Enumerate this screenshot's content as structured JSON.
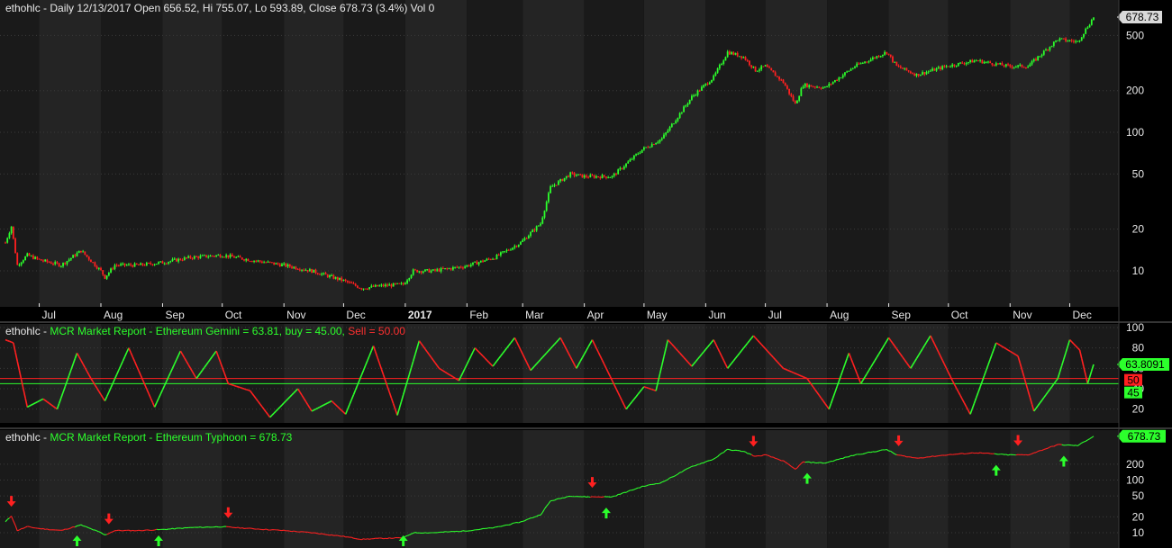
{
  "panel1": {
    "symbol": "ethohlc",
    "header": "Daily 12/13/2017 Open 656.52, Hi 755.07, Lo 593.89, Close 678.73 (3.4%) Vol 0",
    "last_price_label": "678.73"
  },
  "panel2": {
    "symbol": "ethohlc",
    "indicator": "MCR Market Report - Ethereum Gemini = 63.81,",
    "buy": "buy = 45.00,",
    "sell": "Sell = 50.00",
    "value_label": "63.8091",
    "sell_label": "50",
    "buy_label": "45"
  },
  "panel3": {
    "symbol": "ethohlc",
    "indicator": "MCR Market Report - Ethereum Typhoon = 678.73",
    "value_label": "678.73"
  },
  "colors": {
    "up": "#2cff2c",
    "down": "#ff2020",
    "background": "#000000",
    "band_a": "#1a1a1a",
    "band_b": "#242424",
    "grid": "#3a3a3a",
    "axis_text": "#e8e8e8",
    "price_badge": "#d9d9d9"
  },
  "chart_data": [
    {
      "type": "candlestick",
      "title": "ethohlc - Daily 12/13/2017 Open 656.52, Hi 755.07, Lo 593.89, Close 678.73 (3.4%) Vol 0",
      "y_scale": "log",
      "ylim": [
        5.5,
        800
      ],
      "yticks": [
        10,
        20,
        50,
        100,
        200,
        500
      ],
      "x_tick_labels": [
        "Jul",
        "Aug",
        "Sep",
        "Oct",
        "Nov",
        "Dec",
        "2017",
        "Feb",
        "Mar",
        "Apr",
        "May",
        "Jun",
        "Jul",
        "Aug",
        "Sep",
        "Oct",
        "Nov",
        "Dec"
      ],
      "x_range": [
        "2016-06-14",
        "2017-12-13"
      ],
      "close_path": [
        [
          "2016-06-14",
          16
        ],
        [
          "2016-06-17",
          21
        ],
        [
          "2016-06-20",
          11
        ],
        [
          "2016-06-25",
          13
        ],
        [
          "2016-07-01",
          12
        ],
        [
          "2016-07-12",
          11
        ],
        [
          "2016-07-22",
          14
        ],
        [
          "2016-08-01",
          10
        ],
        [
          "2016-08-03",
          9
        ],
        [
          "2016-08-08",
          11
        ],
        [
          "2016-08-20",
          11
        ],
        [
          "2016-09-01",
          11.5
        ],
        [
          "2016-09-15",
          12.5
        ],
        [
          "2016-10-01",
          13
        ],
        [
          "2016-10-15",
          12
        ],
        [
          "2016-11-01",
          11
        ],
        [
          "2016-11-15",
          10
        ],
        [
          "2016-12-01",
          8.5
        ],
        [
          "2016-12-10",
          7.5
        ],
        [
          "2016-12-20",
          7.8
        ],
        [
          "2016-12-31",
          8
        ],
        [
          "2017-01-05",
          10
        ],
        [
          "2017-01-15",
          10
        ],
        [
          "2017-01-31",
          10.8
        ],
        [
          "2017-02-15",
          12.5
        ],
        [
          "2017-02-28",
          16
        ],
        [
          "2017-03-10",
          22
        ],
        [
          "2017-03-15",
          40
        ],
        [
          "2017-03-25",
          50
        ],
        [
          "2017-04-01",
          48
        ],
        [
          "2017-04-15",
          48
        ],
        [
          "2017-04-30",
          75
        ],
        [
          "2017-05-10",
          90
        ],
        [
          "2017-05-25",
          180
        ],
        [
          "2017-06-05",
          250
        ],
        [
          "2017-06-12",
          380
        ],
        [
          "2017-06-20",
          350
        ],
        [
          "2017-06-26",
          280
        ],
        [
          "2017-07-01",
          300
        ],
        [
          "2017-07-10",
          230
        ],
        [
          "2017-07-16",
          160
        ],
        [
          "2017-07-20",
          220
        ],
        [
          "2017-07-31",
          210
        ],
        [
          "2017-08-15",
          300
        ],
        [
          "2017-08-31",
          380
        ],
        [
          "2017-09-05",
          300
        ],
        [
          "2017-09-15",
          260
        ],
        [
          "2017-09-30",
          300
        ],
        [
          "2017-10-15",
          330
        ],
        [
          "2017-10-31",
          300
        ],
        [
          "2017-11-10",
          300
        ],
        [
          "2017-11-25",
          470
        ],
        [
          "2017-12-05",
          450
        ],
        [
          "2017-12-13",
          678.73
        ]
      ]
    },
    {
      "type": "line",
      "title": "ethohlc - MCR Market Report - Ethereum Gemini = 63.81, buy = 45.00, Sell = 50.00",
      "y_scale": "linear",
      "ylim": [
        10,
        100
      ],
      "yticks": [
        20,
        40,
        60,
        80,
        100
      ],
      "sell_level": 50,
      "buy_level": 45,
      "last_value": 63.8091,
      "series": [
        {
          "name": "Ethereum Gemini",
          "points": [
            [
              "2016-06-14",
              88
            ],
            [
              "2016-06-18",
              85
            ],
            [
              "2016-06-25",
              22
            ],
            [
              "2016-07-03",
              30
            ],
            [
              "2016-07-10",
              20
            ],
            [
              "2016-07-20",
              75
            ],
            [
              "2016-07-27",
              50
            ],
            [
              "2016-08-03",
              28
            ],
            [
              "2016-08-15",
              80
            ],
            [
              "2016-08-28",
              22
            ],
            [
              "2016-09-10",
              77
            ],
            [
              "2016-09-18",
              50
            ],
            [
              "2016-09-28",
              77
            ],
            [
              "2016-10-04",
              45
            ],
            [
              "2016-10-15",
              38
            ],
            [
              "2016-10-25",
              12
            ],
            [
              "2016-11-08",
              40
            ],
            [
              "2016-11-15",
              18
            ],
            [
              "2016-11-25",
              28
            ],
            [
              "2016-12-02",
              15
            ],
            [
              "2016-12-16",
              82
            ],
            [
              "2016-12-28",
              14
            ],
            [
              "2017-01-08",
              87
            ],
            [
              "2017-01-18",
              60
            ],
            [
              "2017-01-28",
              48
            ],
            [
              "2017-02-05",
              80
            ],
            [
              "2017-02-14",
              62
            ],
            [
              "2017-02-25",
              90
            ],
            [
              "2017-03-05",
              58
            ],
            [
              "2017-03-20",
              90
            ],
            [
              "2017-03-28",
              60
            ],
            [
              "2017-04-05",
              88
            ],
            [
              "2017-04-12",
              60
            ],
            [
              "2017-04-22",
              20
            ],
            [
              "2017-05-01",
              42
            ],
            [
              "2017-05-07",
              38
            ],
            [
              "2017-05-13",
              88
            ],
            [
              "2017-05-25",
              62
            ],
            [
              "2017-06-05",
              88
            ],
            [
              "2017-06-12",
              60
            ],
            [
              "2017-06-25",
              92
            ],
            [
              "2017-07-10",
              60
            ],
            [
              "2017-07-22",
              50
            ],
            [
              "2017-08-02",
              20
            ],
            [
              "2017-08-12",
              75
            ],
            [
              "2017-08-18",
              45
            ],
            [
              "2017-09-01",
              90
            ],
            [
              "2017-09-12",
              60
            ],
            [
              "2017-09-22",
              92
            ],
            [
              "2017-10-03",
              48
            ],
            [
              "2017-10-12",
              15
            ],
            [
              "2017-10-25",
              85
            ],
            [
              "2017-11-05",
              72
            ],
            [
              "2017-11-13",
              18
            ],
            [
              "2017-11-25",
              50
            ],
            [
              "2017-12-01",
              88
            ],
            [
              "2017-12-06",
              78
            ],
            [
              "2017-12-10",
              45
            ],
            [
              "2017-12-13",
              63.81
            ]
          ]
        }
      ]
    },
    {
      "type": "line",
      "title": "ethohlc - MCR Market Report - Ethereum Typhoon = 678.73",
      "y_scale": "log",
      "ylim": [
        6,
        700
      ],
      "yticks": [
        10,
        20,
        50,
        100,
        200
      ],
      "last_value": 678.73,
      "signals": {
        "sell": [
          "2016-06-17",
          "2016-08-05",
          "2016-10-04",
          "2017-04-05",
          "2017-06-25",
          "2017-09-06",
          "2017-11-05"
        ],
        "buy": [
          "2016-07-20",
          "2016-08-30",
          "2016-12-31",
          "2017-04-12",
          "2017-07-22",
          "2017-10-25",
          "2017-11-28"
        ]
      }
    }
  ]
}
